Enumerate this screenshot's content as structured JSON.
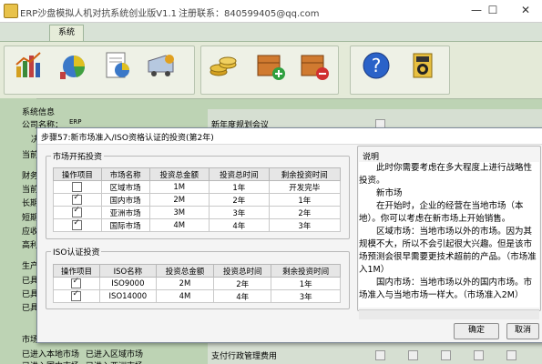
{
  "window": {
    "title": "ERP沙盘模拟人机对抗系统创业版V1.1",
    "registration": "注册联系：840599405@qq.com",
    "controls": [
      "—",
      "☐",
      "✕"
    ]
  },
  "menu": {
    "tab": "系统"
  },
  "toolbar": {
    "icons": [
      "chart-icon",
      "pie-chart-icon",
      "report-icon",
      "truck-icon",
      "coins-icon",
      "add-box-icon",
      "remove-box-icon",
      "help-icon",
      "website-icon"
    ]
  },
  "background": {
    "section_title": "系统信息",
    "company_label": "公司名称：",
    "company_value": "ERP",
    "left_labels": [
      "决",
      "当前",
      "财务",
      "当前",
      "长期",
      "短期",
      "应收",
      "高利",
      "生产",
      "已具",
      "已具",
      "已具",
      "市场"
    ],
    "bottom_left_1": "已进入本地市场",
    "bottom_left_2": "已进入区域市场",
    "bottom_left_3": "已进入国内市场",
    "bottom_left_4": "已进入亚洲市场",
    "right_row_top": "新年度规划会议",
    "right_row_bottom": "支付行政管理费用"
  },
  "dialog": {
    "title": "步骤57:新市场准入/ISO资格认证的投资(第2年)",
    "market_group": {
      "caption": "市场开拓投资",
      "headers": [
        "操作项目",
        "市场名称",
        "投资总金额",
        "投资总时间",
        "剩余投资时间"
      ],
      "rows": [
        {
          "checked": false,
          "name": "区域市场",
          "amount": "1M",
          "time": "1年",
          "remain": "开发完毕"
        },
        {
          "checked": true,
          "name": "国内市场",
          "amount": "2M",
          "time": "2年",
          "remain": "1年"
        },
        {
          "checked": true,
          "name": "亚洲市场",
          "amount": "3M",
          "time": "3年",
          "remain": "2年"
        },
        {
          "checked": true,
          "name": "国际市场",
          "amount": "4M",
          "time": "4年",
          "remain": "3年"
        }
      ]
    },
    "iso_group": {
      "caption": "ISO认证投资",
      "headers": [
        "操作项目",
        "ISO名称",
        "投资总金额",
        "投资总时间",
        "剩余投资时间"
      ],
      "rows": [
        {
          "checked": true,
          "name": "ISO9000",
          "amount": "2M",
          "time": "2年",
          "remain": "1年"
        },
        {
          "checked": true,
          "name": "ISO14000",
          "amount": "4M",
          "time": "4年",
          "remain": "3年"
        }
      ]
    },
    "description": {
      "caption": "说明",
      "paragraphs": [
        "此时你需要考虑在多大程度上进行战略性投资。",
        "新市场",
        "在开始时，企业的经营在当地市场（本地）。你可以考虑在新市场上开始销售。",
        "区域市场：当地市场以外的市场。因为其规模不大，所以不会引起很大兴趣。但是该市场预测会很早需要更技术超前的产品。（市场准入1M）",
        "国内市场：当地市场以外的国内市场。市场准入与当地市场一样大。（市场准入2M）"
      ]
    },
    "ok_label": "确定",
    "cancel_label": "取消"
  }
}
